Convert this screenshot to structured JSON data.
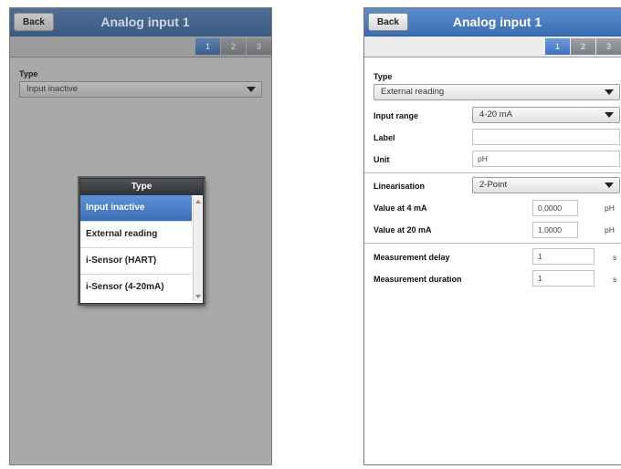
{
  "left_screen": {
    "back_label": "Back",
    "title": "Analog input 1",
    "tabs": [
      "1",
      "2",
      "3"
    ],
    "type_label": "Type",
    "type_value": "Input inactive",
    "popup": {
      "title": "Type",
      "options": [
        "Input inactive",
        "External reading",
        "i-Sensor (HART)",
        "i-Sensor (4-20mA)"
      ],
      "selected": "Input inactive"
    }
  },
  "right_screen": {
    "back_label": "Back",
    "title": "Analog input 1",
    "tabs": [
      "1",
      "2",
      "3"
    ],
    "type_label": "Type",
    "type_value": "External reading",
    "input_range_label": "Input range",
    "input_range_value": "4-20 mA",
    "label_label": "Label",
    "label_value": "",
    "unit_label": "Unit",
    "unit_value": "pH",
    "linearisation_label": "Linearisation",
    "linearisation_value": "2-Point",
    "value4_label": "Value at 4 mA",
    "value4_value": "0,0000",
    "value4_unit": "pH",
    "value20_label": "Value at 20 mA",
    "value20_value": "1,0000",
    "value20_unit": "pH",
    "delay_label": "Measurement delay",
    "delay_value": "1",
    "delay_unit": "s",
    "duration_label": "Measurement duration",
    "duration_value": "1",
    "duration_unit": "s"
  }
}
